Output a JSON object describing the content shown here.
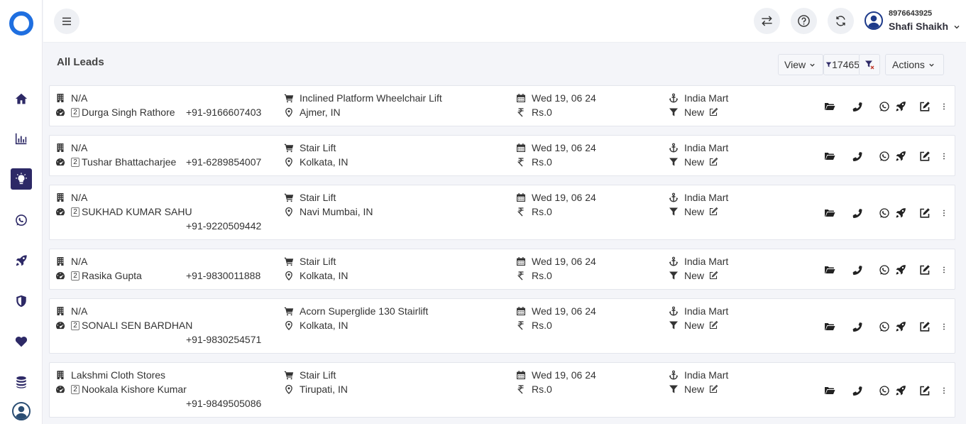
{
  "app": {
    "logo": "app-logo"
  },
  "sidebar": {
    "items": [
      {
        "icon": "home-icon"
      },
      {
        "icon": "bar-chart-icon"
      },
      {
        "icon": "lightbulb-icon",
        "active": true
      },
      {
        "icon": "whatsapp-icon"
      },
      {
        "icon": "rocket-icon"
      },
      {
        "icon": "shield-icon"
      },
      {
        "icon": "heart-icon"
      },
      {
        "icon": "database-icon"
      },
      {
        "icon": "user-circle-icon"
      }
    ]
  },
  "topbar": {
    "menu_icon": "hamburger-icon",
    "buttons": [
      "swap-icon",
      "help-icon",
      "refresh-icon"
    ],
    "user": {
      "phone": "8976643925",
      "name": "Shafi Shaikh"
    }
  },
  "page": {
    "title": "All Leads",
    "view_label": "View",
    "filter_count": "17465",
    "actions_label": "Actions"
  },
  "leads": [
    {
      "company": "N/A",
      "contact": "Durga Singh Rathore",
      "badge": "2",
      "phone": "+91-9166607403",
      "product": "Inclined Platform Wheelchair Lift",
      "location": "Ajmer, IN",
      "date": "Wed 19, 06 24",
      "amount": "Rs.0",
      "source": "India Mart",
      "status": "New"
    },
    {
      "company": "N/A",
      "contact": "Tushar Bhattacharjee",
      "badge": "2",
      "phone": "+91-6289854007",
      "product": "Stair Lift",
      "location": "Kolkata, IN",
      "date": "Wed 19, 06 24",
      "amount": "Rs.0",
      "source": "India Mart",
      "status": "New"
    },
    {
      "company": "N/A",
      "contact": "SUKHAD KUMAR SAHU",
      "badge": "2",
      "phone": "+91-9220509442",
      "product": "Stair Lift",
      "location": "Navi Mumbai, IN",
      "date": "Wed 19, 06 24",
      "amount": "Rs.0",
      "source": "India Mart",
      "status": "New"
    },
    {
      "company": "N/A",
      "contact": "Rasika Gupta",
      "badge": "2",
      "phone": "+91-9830011888",
      "product": "Stair Lift",
      "location": "Kolkata, IN",
      "date": "Wed 19, 06 24",
      "amount": "Rs.0",
      "source": "India Mart",
      "status": "New"
    },
    {
      "company": "N/A",
      "contact": "SONALI SEN BARDHAN",
      "badge": "2",
      "phone": "+91-9830254571",
      "product": "Acorn Superglide 130 Stairlift",
      "location": "Kolkata, IN",
      "date": "Wed 19, 06 24",
      "amount": "Rs.0",
      "source": "India Mart",
      "status": "New"
    },
    {
      "company": "Lakshmi Cloth Stores",
      "contact": "Nookala Kishore Kumar",
      "badge": "2",
      "phone": "+91-9849505086",
      "product": "Stair Lift",
      "location": "Tirupati, IN",
      "date": "Wed 19, 06 24",
      "amount": "Rs.0",
      "source": "India Mart",
      "status": "New"
    }
  ],
  "row_actions": [
    "folder-icon",
    "phone-icon",
    "whatsapp-icon",
    "rocket-icon",
    "edit-icon",
    "more-vertical-icon"
  ]
}
